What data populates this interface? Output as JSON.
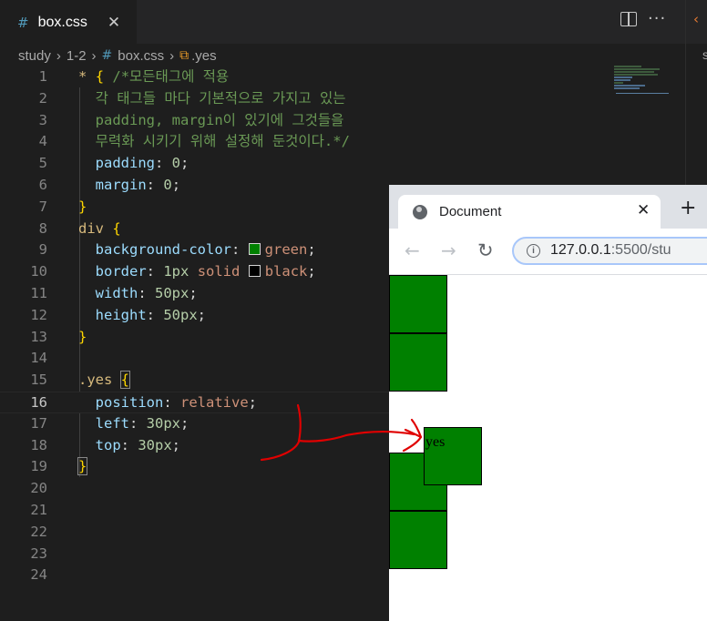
{
  "editor": {
    "tab": {
      "icon": "css-hash-icon",
      "filename": "box.css",
      "close": "✕"
    },
    "breadcrumb": {
      "items": [
        "study",
        "1-2",
        "box.css",
        ".yes"
      ]
    },
    "lines": [
      {
        "n": "1"
      },
      {
        "n": "2"
      },
      {
        "n": "3"
      },
      {
        "n": "4"
      },
      {
        "n": "5"
      },
      {
        "n": "6"
      },
      {
        "n": "7"
      },
      {
        "n": "8"
      },
      {
        "n": "9"
      },
      {
        "n": "10"
      },
      {
        "n": "11"
      },
      {
        "n": "12"
      },
      {
        "n": "13"
      },
      {
        "n": "14"
      },
      {
        "n": "15"
      },
      {
        "n": "16"
      },
      {
        "n": "17"
      },
      {
        "n": "18"
      },
      {
        "n": "19"
      },
      {
        "n": "20"
      },
      {
        "n": "21"
      },
      {
        "n": "22"
      },
      {
        "n": "23"
      },
      {
        "n": "24"
      }
    ],
    "code": {
      "l1_sel": "*",
      "l1_open": "{",
      "l1_com": "/*모든태그에 적용",
      "l2_com": "각 태그들 마다 기본적으로 가지고 있는",
      "l3_com": "padding, margin이 있기에 그것들을",
      "l4_com": "무력화 시키기 위해 설정해 둔것이다.*/",
      "l5_prop": "padding",
      "l5_val": "0",
      "l6_prop": "margin",
      "l6_val": "0",
      "l7_close": "}",
      "l8_sel": "div",
      "l8_open": "{",
      "l9_prop": "background-color",
      "l9_val": "green",
      "l9_swatch": "#008000",
      "l10_prop": "border",
      "l10_num": "1px",
      "l10_kw": "solid",
      "l10_val": "black",
      "l10_swatch": "#000000",
      "l11_prop": "width",
      "l11_val": "50px",
      "l12_prop": "height",
      "l12_val": "50px",
      "l13_close": "}",
      "l15_sel": ".yes",
      "l15_open": "{",
      "l16_prop": "position",
      "l16_val": "relative",
      "l17_prop": "left",
      "l17_val": "30px",
      "l18_prop": "top",
      "l18_val": "30px",
      "l19_close": "}"
    },
    "active_line": "16",
    "colors": {
      "background": "#1e1e1e",
      "selector": "#d7ba7d",
      "comment": "#6a9955",
      "property": "#9cdcfe",
      "number": "#b5cea8",
      "string": "#ce9178"
    }
  },
  "browser": {
    "tab_title": "Document",
    "tab_close": "✕",
    "new_tab": "+",
    "url_host": "127.0.0.1",
    "url_rest": ":5500/stu",
    "boxes": [
      {
        "label": ""
      },
      {
        "label": ""
      },
      {
        "label": "yes"
      },
      {
        "label": ""
      },
      {
        "label": ""
      }
    ],
    "box_color": "#008000"
  },
  "annotation": {
    "color": "#e00000",
    "description": "hand-drawn red arrow"
  }
}
